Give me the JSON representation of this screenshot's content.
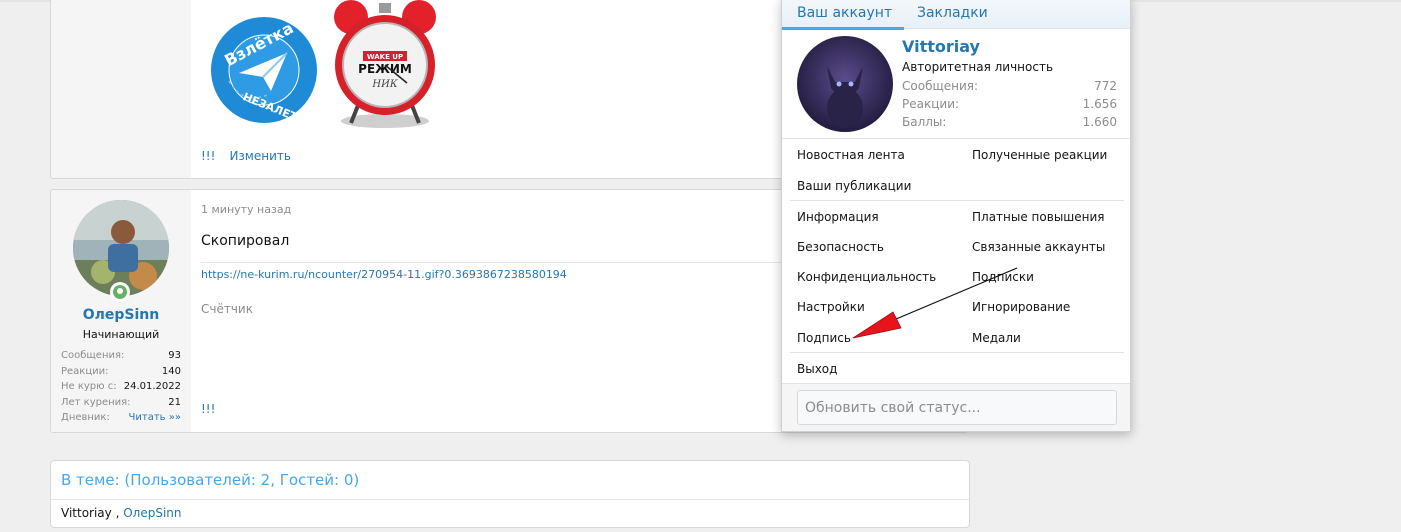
{
  "post1": {
    "actions": {
      "bang": "!!!",
      "edit": "Изменить"
    }
  },
  "post2": {
    "user": {
      "name": "ОлерSinn",
      "title": "Начинающий",
      "stats": [
        {
          "label": "Сообщения:",
          "value": "93"
        },
        {
          "label": "Реакции:",
          "value": "140"
        },
        {
          "label": "Не курю с:",
          "value": "24.01.2022"
        },
        {
          "label": "Лет курения:",
          "value": "21"
        },
        {
          "label": "Дневник:",
          "value": "Читать »»"
        }
      ]
    },
    "time": "1 минуту назад",
    "text": "Скопировал",
    "signature_url": "https://ne-kurim.ru/ncounter/270954-11.gif?0.3693867238580194",
    "counter": "Счётчик",
    "bang": "!!!"
  },
  "online": {
    "title": "В теме: (Пользователей: 2, Гостей: 0)",
    "user1": "Vittoriay",
    "separator": " , ",
    "user2": "ОлерSinn"
  },
  "menu": {
    "tabs": {
      "account": "Ваш аккаунт",
      "bookmarks": "Закладки"
    },
    "user": {
      "name": "Vittoriay",
      "title": "Авторитетная личность",
      "stats": [
        {
          "label": "Сообщения:",
          "value": "772"
        },
        {
          "label": "Реакции:",
          "value": "1.656"
        },
        {
          "label": "Баллы:",
          "value": "1.660"
        }
      ]
    },
    "items": {
      "news_feed": "Новостная лента",
      "received_reactions": "Полученные реакции",
      "your_posts": "Ваши публикации",
      "info": "Информация",
      "paid_upgrades": "Платные повышения",
      "security": "Безопасность",
      "connected_accounts": "Связанные аккаунты",
      "privacy": "Конфиденциальность",
      "following": "Подписки",
      "preferences": "Настройки",
      "ignoring": "Игнорирование",
      "signature": "Подпись",
      "medals": "Медали",
      "logout": "Выход"
    },
    "status_placeholder": "Обновить свой статус..."
  },
  "colors": {
    "link": "#2577b1",
    "accent": "#47a7eb",
    "muted": "#8c8c8c",
    "online_dot": "#63b265",
    "annotation_arrow": "#e8141c"
  },
  "images": {
    "plane_sticker": {
      "line1": "Взлётка",
      "line2": "НЕЗАЛЕТКА"
    },
    "clock_sticker": {
      "line1": "WAKE UP",
      "line2": "РЕЖИМ",
      "line3": "НИК"
    }
  }
}
